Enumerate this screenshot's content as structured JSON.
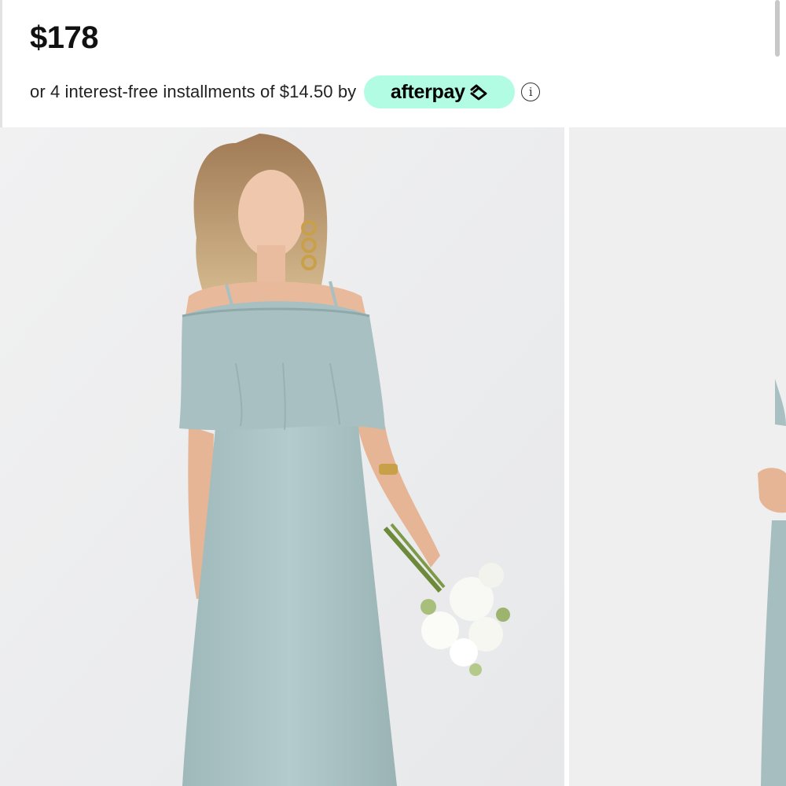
{
  "product": {
    "price": "$178"
  },
  "afterpay": {
    "text": "or 4 interest-free installments of $14.50 by",
    "brand": "afterpay",
    "badge_color": "#b2fce4",
    "info_icon": "info-icon"
  },
  "gallery": {
    "images": [
      {
        "name": "model-front-view",
        "dress_color": "#a9c2c3",
        "background": "#eeeeef"
      },
      {
        "name": "model-side-view",
        "dress_color": "#a9c2c3",
        "background": "#efefef"
      }
    ]
  }
}
